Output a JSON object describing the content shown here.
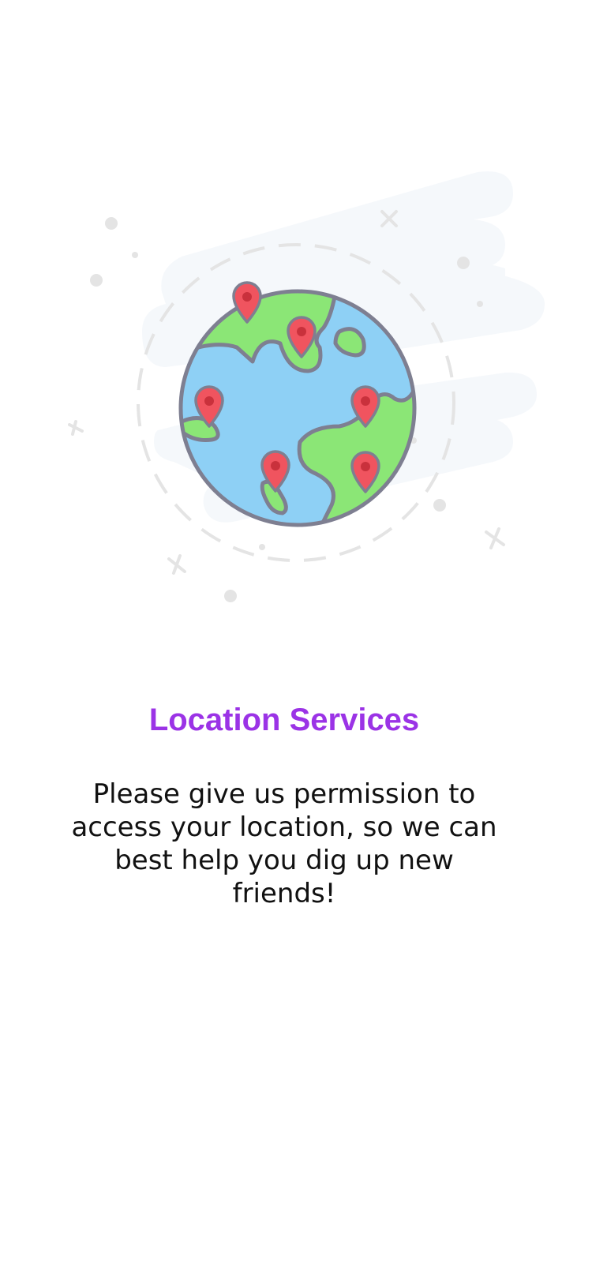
{
  "screen": {
    "title": "Location Services",
    "message": "Please give us permission to access your location, so we can best help you dig up new friends!"
  },
  "illustration": {
    "icon": "globe-with-location-pins-icon",
    "pin_icon": "location-pin-icon",
    "pin_count": 6
  },
  "colors": {
    "title": "#9B33E6",
    "body_text": "#111111",
    "background": "#FFFFFF",
    "ocean": "#8ED0F5",
    "land": "#8BE676",
    "outline": "#7E7F91",
    "pin": "#F0545F",
    "pin_dot": "#C9313C",
    "cloud": "#F5F8FB",
    "decoration": "#E4E4E4"
  }
}
